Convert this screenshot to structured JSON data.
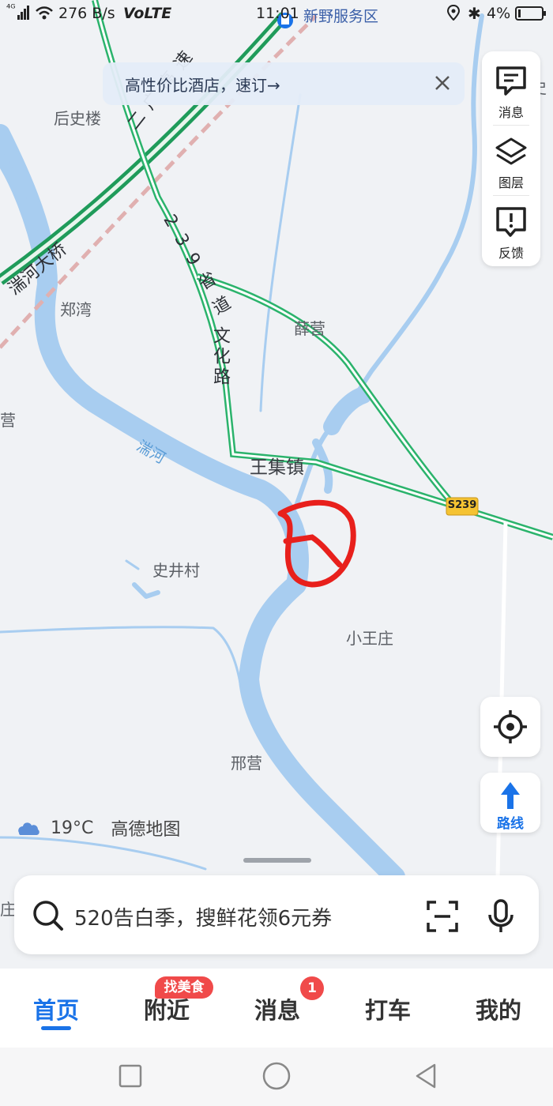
{
  "status_bar": {
    "signal": "⁴ᴳ",
    "net_speed": "276 B/s",
    "volte": "VoLTE",
    "time": "11:01",
    "battery": "4%"
  },
  "map": {
    "labels": {
      "houshilou": "后史楼",
      "expressway": "二广高速",
      "bridge": "湍河大桥",
      "provincial_road": "239省道",
      "zhengwan": "郑湾",
      "xueying": "薛营",
      "wenhua_road": "文化路",
      "ying_left": "营",
      "tuanhe": "湍河",
      "wangji": "王集镇",
      "s239": "S239",
      "shijing": "史井村",
      "xiaowang": "小王庄",
      "xingying": "邢营",
      "service_area": "新野服务区",
      "shi_right": "史",
      "zhuang_left": "庄"
    }
  },
  "promo": {
    "text": "高性价比酒店，速订→"
  },
  "tools": {
    "message": "消息",
    "layers": "图层",
    "feedback": "反馈"
  },
  "route_button": {
    "label": "路线"
  },
  "weather": {
    "temp": "19°C",
    "brand": "高德地图"
  },
  "search": {
    "placeholder": "520告白季，搜鲜花领6元券"
  },
  "tabs": {
    "home": "首页",
    "nearby": "附近",
    "nearby_badge": "找美食",
    "messages": "消息",
    "messages_badge": "1",
    "taxi": "打车",
    "mine": "我的"
  },
  "colors": {
    "accent": "#1a73e8",
    "river": "#a8cdf0",
    "road_green": "#27b06a",
    "badge_red": "#f04a4a",
    "annotation_red": "#e8201c"
  }
}
